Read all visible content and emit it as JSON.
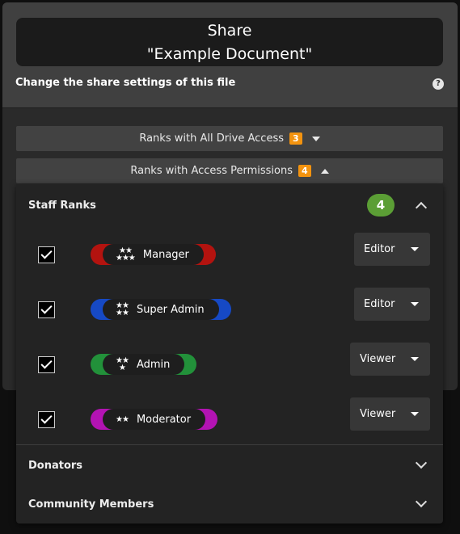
{
  "title": {
    "line1": "Share",
    "line2": "\"Example Document\""
  },
  "subtitle": "Change the share settings of this file",
  "help_icon": "?",
  "sections": {
    "all_drive": {
      "label": "Ranks with All Drive Access",
      "count": "3"
    },
    "access": {
      "label": "Ranks with Access Permissions",
      "count": "4"
    }
  },
  "groups": {
    "staff": {
      "label": "Staff Ranks",
      "count": "4"
    },
    "donators": {
      "label": "Donators"
    },
    "community": {
      "label": "Community Members"
    }
  },
  "ranks": [
    {
      "name": "Manager",
      "color": "#b3130f",
      "role": "Editor",
      "stars": "5-stars"
    },
    {
      "name": "Super Admin",
      "color": "#1649c5",
      "role": "Editor",
      "stars": "4-stars"
    },
    {
      "name": "Admin",
      "color": "#22913a",
      "role": "Viewer",
      "stars": "3-stars"
    },
    {
      "name": "Moderator",
      "color": "#b313b3",
      "role": "Viewer",
      "stars": "2-stars"
    }
  ]
}
